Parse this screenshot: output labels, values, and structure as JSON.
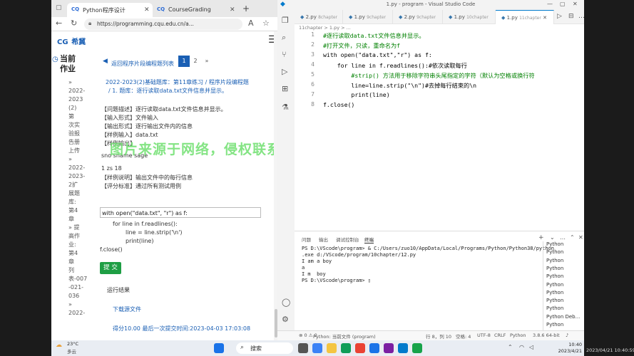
{
  "browser": {
    "tabs": [
      {
        "favicon": "CQ",
        "label": "Python程序设计"
      },
      {
        "favicon": "CQ",
        "label": "CourseGrading"
      }
    ],
    "new_tab": "+",
    "url": "https://programming.cqu.edu.cn/a...",
    "page": {
      "logo_mark": "CG",
      "logo_text": "希冀",
      "current_label": "当前\n作业",
      "left_items": [
        "»",
        "2022-",
        "2023",
        "(2)",
        "第",
        "次实",
        "验报",
        "告册",
        "上传",
        "»",
        "2022-",
        "2023-",
        "2扩",
        "展题",
        "库:",
        "第4",
        "章",
        "» 提",
        "高作",
        "业:",
        "第4",
        "章",
        "列",
        "表-007",
        "-021-",
        "036",
        "»",
        "2022-"
      ],
      "back_link": "返回程序片段编程题列表",
      "pages": [
        "1",
        "2",
        "»"
      ],
      "breadcrumb1": "2022-2023(2)基础题库：第11章练习 / 程序片段编程题",
      "breadcrumb2": "/ 1. 题库：逐行读取data.txt文件信息并显示。",
      "problem_lines": [
        "【问题描述】逐行读取data.txt文件信息并显示。",
        "【输入形式】文件输入",
        "【输出形式】逐行输出文件内的信息",
        "【样例输入】data.txt",
        "【样例输出】",
        "sno sname sage",
        "1     zs      18",
        "【样例说明】输出文件中的每行信息",
        "【评分标准】通过所有测试用例"
      ],
      "code_input": "with open(\"data.txt\", \"r\") as f:",
      "code_lines": [
        "for  line  in  f.readlines():",
        "line  =  line.strip('\\n')",
        "print(line)",
        "f.close()"
      ],
      "submit": "提 交",
      "result_label": "运行结果",
      "download": "下载源文件",
      "score": "得分10.00   最后一次提交时间:2023-04-03 17:03:08",
      "watermark": "图片来源于网络，侵权联系站长删除！"
    }
  },
  "vscode": {
    "title": "1.py - program - Visual Studio Code",
    "tabs": [
      {
        "label": "2.py",
        "hint": "8chapter"
      },
      {
        "label": "1.py",
        "hint": "9chapter"
      },
      {
        "label": "2.py",
        "hint": "9chapter"
      },
      {
        "label": "1.py",
        "hint": "10chapter"
      },
      {
        "label": "1.py",
        "hint": "11chapter"
      }
    ],
    "breadcrumb": "11chapter  >  1.py  >  ...",
    "code": [
      {
        "n": "1",
        "t": "#逐行读取data.txt文件信息并显示。"
      },
      {
        "n": "2",
        "t": "#打开文件，只读，重命名为f"
      },
      {
        "n": "3",
        "t": "with open(\"data.txt\",\"r\") as f:"
      },
      {
        "n": "4",
        "t": "    for line in f.readlines():#依次读取每行"
      },
      {
        "n": "5",
        "t": "        #strip() 方法用于移除字符串头尾指定的字符（默认为空格或换行符"
      },
      {
        "n": "6",
        "t": "        line=line.strip(\"\\n\")#去掉每行结束的\\n"
      },
      {
        "n": "7",
        "t": "        print(line)"
      },
      {
        "n": "8",
        "t": "f.close()"
      }
    ],
    "panel_tabs": [
      "问题",
      "输出",
      "调试控制台",
      "终端"
    ],
    "terminal": [
      "PS D:\\VScode\\program> & C:/Users/zuo10/AppData/Local/Programs/Python/Python38/python",
      ".exe d:/VScode/program/10chapter/12.py",
      "I am a boy",
      "a",
      "I m  boy",
      "PS D:\\VScode\\program> "
    ],
    "terminal_list": [
      "Python",
      "Python",
      "Python",
      "Python",
      "Python",
      "Python",
      "Python",
      "Python",
      "Python",
      "Python Deb...",
      "Python"
    ],
    "status": {
      "left": "⊗ 0 ⚠ 0",
      "python": "Python: 当前文件 (program)",
      "pos": "行 8，列 10",
      "spaces": "空格: 4",
      "enc": "UTF-8",
      "eol": "CRLF",
      "lang": "Python",
      "version": "3.8.6 64-bit"
    }
  },
  "taskbar": {
    "weather_temp": "23°C",
    "weather_desc": "多云",
    "search": "搜索",
    "time": "10:40",
    "date": "2023/4/21",
    "overlay_time": "2023/04/21 10:40:59"
  },
  "colors": {
    "accent": "#1a5fb4",
    "submit": "#1e9e44",
    "watermark": "#6fe06f"
  }
}
